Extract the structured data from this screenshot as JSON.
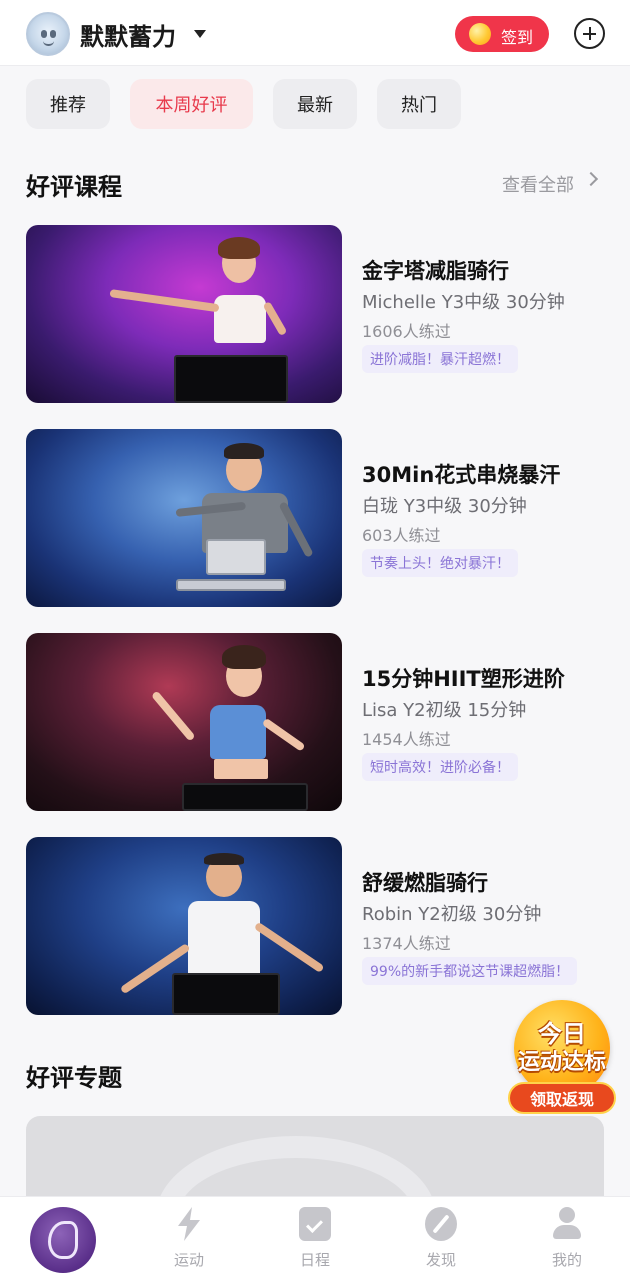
{
  "header": {
    "username": "默默蓄力",
    "signin_label": "签到"
  },
  "tabs": [
    {
      "label": "推荐",
      "active": false
    },
    {
      "label": "本周好评",
      "active": true
    },
    {
      "label": "最新",
      "active": false
    },
    {
      "label": "热门",
      "active": false
    }
  ],
  "courses_section": {
    "title": "好评课程",
    "see_all": "查看全部"
  },
  "courses": [
    {
      "title": "金字塔减脂骑行",
      "meta": "Michelle Y3中级 30分钟",
      "count": "1606人练过",
      "tag": "进阶减脂！暴汗超燃！"
    },
    {
      "title": "30Min花式串烧暴汗",
      "meta": "白珑 Y3中级 30分钟",
      "count": "603人练过",
      "tag": "节奏上头！绝对暴汗！"
    },
    {
      "title": "15分钟HIIT塑形进阶",
      "meta": "Lisa Y2初级 15分钟",
      "count": "1454人练过",
      "tag": "短时高效！进阶必备！"
    },
    {
      "title": "舒缓燃脂骑行",
      "meta": "Robin Y2初级 30分钟",
      "count": "1374人练过",
      "tag": "99%的新手都说这节课超燃脂！"
    }
  ],
  "topics_section": {
    "title": "好评专题"
  },
  "promo": {
    "line1": "今日",
    "line2": "运动达标",
    "button": "领取返现"
  },
  "bottom_nav": {
    "items": [
      {
        "label": "运动",
        "icon": "lightning-icon"
      },
      {
        "label": "日程",
        "icon": "calendar-check-icon"
      },
      {
        "label": "发现",
        "icon": "compass-icon"
      },
      {
        "label": "我的",
        "icon": "person-icon"
      }
    ]
  },
  "colors": {
    "accent_red": "#f0354a",
    "tab_active_text": "#e83a4c",
    "tag_text": "#8a74d6",
    "tag_bg": "#efedfb"
  }
}
